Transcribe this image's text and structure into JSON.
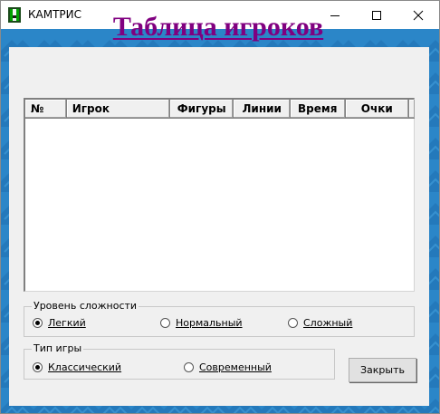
{
  "window": {
    "title": "КАМТРИС",
    "background_color": "#2b86c8"
  },
  "main": {
    "heading": "Таблица игроков",
    "heading_color": "#800080",
    "table": {
      "columns": [
        "№",
        "Игрок",
        "Фигуры",
        "Линии",
        "Время",
        "Очки"
      ],
      "rows": []
    }
  },
  "difficulty": {
    "legend": "Уровень сложности",
    "options": [
      {
        "label": "Легкий",
        "selected": true
      },
      {
        "label": "Нормальный",
        "selected": false
      },
      {
        "label": "Сложный",
        "selected": false
      }
    ]
  },
  "game_type": {
    "legend": "Тип игры",
    "options": [
      {
        "label": "Классический",
        "selected": true
      },
      {
        "label": "Современный",
        "selected": false
      }
    ]
  },
  "actions": {
    "close_label": "Закрыть"
  }
}
